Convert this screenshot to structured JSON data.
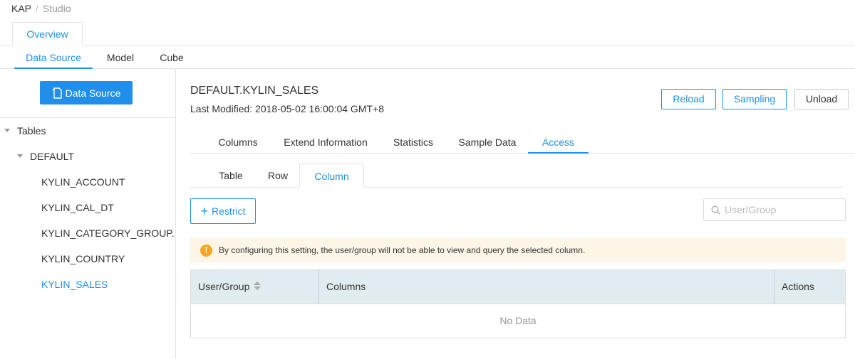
{
  "breadcrumb": {
    "root": "KAP",
    "separator": "/",
    "current": "Studio"
  },
  "top_tabs": {
    "overview": "Overview"
  },
  "sub_tabs": {
    "data_source": "Data Source",
    "model": "Model",
    "cube": "Cube"
  },
  "sidebar": {
    "add_button": "Data Source",
    "tree": {
      "root": "Tables",
      "database": "DEFAULT",
      "tables": [
        "KYLIN_ACCOUNT",
        "KYLIN_CAL_DT",
        "KYLIN_CATEGORY_GROUP.",
        "KYLIN_COUNTRY",
        "KYLIN_SALES"
      ]
    }
  },
  "table_detail": {
    "name": "DEFAULT.KYLIN_SALES",
    "last_modified": "Last Modified: 2018-05-02 16:00:04 GMT+8",
    "actions": {
      "reload": "Reload",
      "sampling": "Sampling",
      "unload": "Unload"
    },
    "tabs": {
      "columns": "Columns",
      "extend": "Extend Information",
      "statistics": "Statistics",
      "sample": "Sample Data",
      "access": "Access"
    }
  },
  "access": {
    "tabs": {
      "table": "Table",
      "row": "Row",
      "column": "Column"
    },
    "restrict_button": "Restrict",
    "search_placeholder": "User/Group",
    "alert": "By configuring this setting, the user/group will not be able to view and query the selected column.",
    "table": {
      "headers": {
        "user_group": "User/Group",
        "columns": "Columns",
        "actions": "Actions"
      },
      "empty": "No Data"
    }
  },
  "colors": {
    "accent": "#218fea",
    "header_bg": "#e0ecef",
    "alert_bg": "#fdf6e7",
    "warn": "#f5a623"
  }
}
